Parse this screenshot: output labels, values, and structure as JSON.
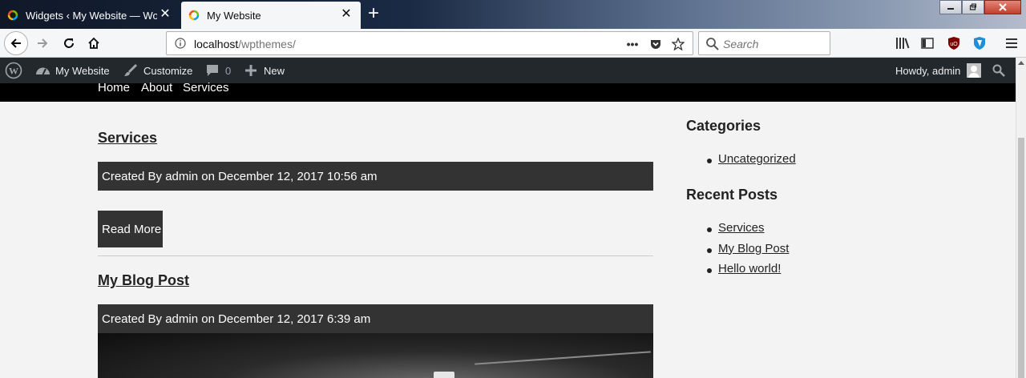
{
  "browser": {
    "tabs": [
      {
        "title": "Widgets ‹ My Website — WordPress",
        "active": false
      },
      {
        "title": "My Website",
        "active": true
      }
    ],
    "new_tab_symbol": "+",
    "close_symbol": "✕",
    "url_host": "localhost",
    "url_path": "/wpthemes/",
    "url_more": "•••",
    "search_placeholder": "Search"
  },
  "adminbar": {
    "site_name": "My Website",
    "customize": "Customize",
    "comments_count": "0",
    "new_label": "New",
    "greeting": "Howdy, admin"
  },
  "sitenav": {
    "items": [
      "Home",
      "About",
      "Services"
    ]
  },
  "posts": [
    {
      "title": "Services",
      "meta": "Created By admin on December 12, 2017 10:56 am",
      "read_more": "Read More"
    },
    {
      "title": "My Blog Post",
      "meta": "Created By admin on December 12, 2017 6:39 am"
    }
  ],
  "sidebar": {
    "categories_title": "Categories",
    "categories": [
      "Uncategorized"
    ],
    "recent_title": "Recent Posts",
    "recent": [
      "Services",
      "My Blog Post",
      "Hello world!"
    ]
  },
  "colors": {
    "adminbar_bg": "#23282d",
    "sitenav_bg": "#000000",
    "meta_bg": "#333333",
    "page_bg": "#f3f3f3"
  }
}
